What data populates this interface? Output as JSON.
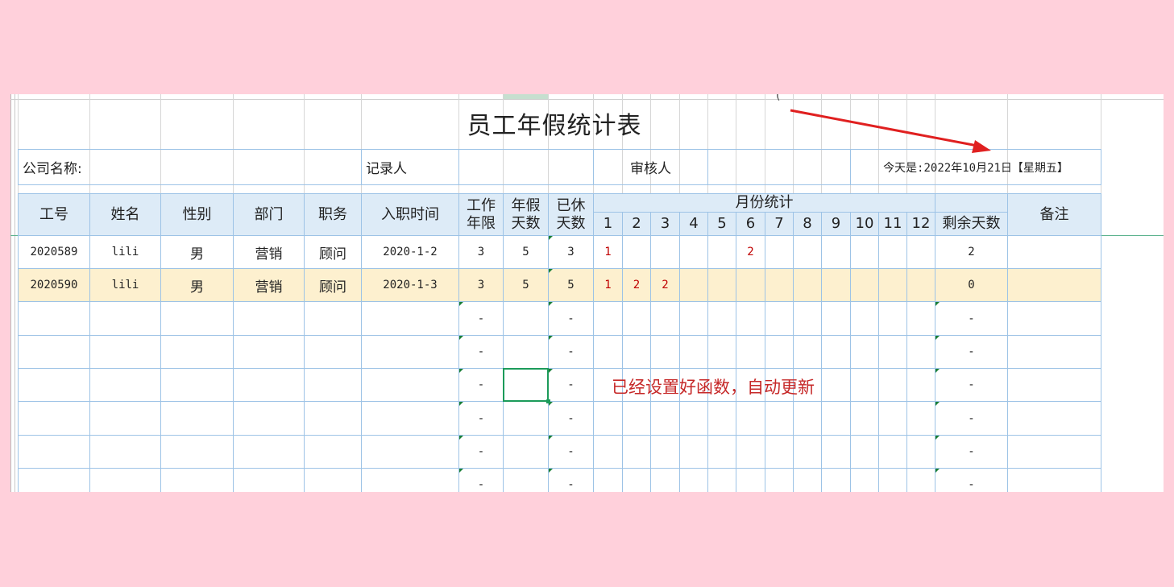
{
  "title": "员工年假统计表",
  "info": {
    "company_label": "公司名称:",
    "recorder_label": "记录人",
    "reviewer_label": "审核人",
    "today_text": "今天是:2022年10月21日【星期五】"
  },
  "headers": {
    "emp_id": "工号",
    "name": "姓名",
    "gender": "性别",
    "dept": "部门",
    "position": "职务",
    "hire_date": "入职时间",
    "work_years_1": "工作",
    "work_years_2": "年限",
    "leave_days_1": "年假",
    "leave_days_2": "天数",
    "used_days_1": "已休",
    "used_days_2": "天数",
    "monthly": "月份统计",
    "months": [
      "1",
      "2",
      "3",
      "4",
      "5",
      "6",
      "7",
      "8",
      "9",
      "10",
      "11",
      "12"
    ],
    "remaining": "剩余天数",
    "remarks": "备注"
  },
  "rows": [
    {
      "emp_id": "2020589",
      "name": "lili",
      "gender": "男",
      "dept": "营销",
      "position": "顾问",
      "hire_date": "2020-1-2",
      "work_years": "3",
      "leave_days": "5",
      "used_days": "3",
      "months": [
        "1",
        "",
        "",
        "",
        "",
        "2",
        "",
        "",
        "",
        "",
        "",
        ""
      ],
      "remaining": "2",
      "remarks": ""
    },
    {
      "emp_id": "2020590",
      "name": "lili",
      "gender": "男",
      "dept": "营销",
      "position": "顾问",
      "hire_date": "2020-1-3",
      "work_years": "3",
      "leave_days": "5",
      "used_days": "5",
      "months": [
        "1",
        "2",
        "2",
        "",
        "",
        "",
        "",
        "",
        "",
        "",
        "",
        ""
      ],
      "remaining": "0",
      "remarks": ""
    },
    {
      "emp_id": "",
      "name": "",
      "gender": "",
      "dept": "",
      "position": "",
      "hire_date": "",
      "work_years": "-",
      "leave_days": "",
      "used_days": "-",
      "months": [
        "",
        "",
        "",
        "",
        "",
        "",
        "",
        "",
        "",
        "",
        "",
        ""
      ],
      "remaining": "-",
      "remarks": ""
    },
    {
      "emp_id": "",
      "name": "",
      "gender": "",
      "dept": "",
      "position": "",
      "hire_date": "",
      "work_years": "-",
      "leave_days": "",
      "used_days": "-",
      "months": [
        "",
        "",
        "",
        "",
        "",
        "",
        "",
        "",
        "",
        "",
        "",
        ""
      ],
      "remaining": "-",
      "remarks": ""
    },
    {
      "emp_id": "",
      "name": "",
      "gender": "",
      "dept": "",
      "position": "",
      "hire_date": "",
      "work_years": "-",
      "leave_days": "",
      "used_days": "-",
      "months": [
        "",
        "",
        "",
        "",
        "",
        "",
        "",
        "",
        "",
        "",
        "",
        ""
      ],
      "remaining": "-",
      "remarks": ""
    },
    {
      "emp_id": "",
      "name": "",
      "gender": "",
      "dept": "",
      "position": "",
      "hire_date": "",
      "work_years": "-",
      "leave_days": "",
      "used_days": "-",
      "months": [
        "",
        "",
        "",
        "",
        "",
        "",
        "",
        "",
        "",
        "",
        "",
        ""
      ],
      "remaining": "-",
      "remarks": ""
    },
    {
      "emp_id": "",
      "name": "",
      "gender": "",
      "dept": "",
      "position": "",
      "hire_date": "",
      "work_years": "-",
      "leave_days": "",
      "used_days": "-",
      "months": [
        "",
        "",
        "",
        "",
        "",
        "",
        "",
        "",
        "",
        "",
        "",
        ""
      ],
      "remaining": "-",
      "remarks": ""
    },
    {
      "emp_id": "",
      "name": "",
      "gender": "",
      "dept": "",
      "position": "",
      "hire_date": "",
      "work_years": "-",
      "leave_days": "",
      "used_days": "-",
      "months": [
        "",
        "",
        "",
        "",
        "",
        "",
        "",
        "",
        "",
        "",
        "",
        ""
      ],
      "remaining": "-",
      "remarks": ""
    }
  ],
  "annotation": "已经设置好函数，自动更新",
  "colors": {
    "background": "#ffd0db",
    "header_fill": "#ddebf7",
    "highlight_row": "#fdf0cf",
    "border": "#9dc3e6",
    "accent_red": "#c00000",
    "selection": "#1c9b5a",
    "arrow": "#e02020"
  }
}
